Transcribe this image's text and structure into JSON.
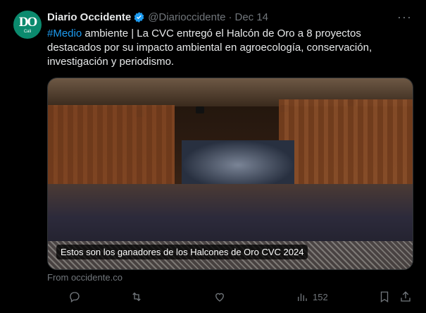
{
  "tweet": {
    "avatar_monogram": "DO",
    "avatar_sub": "Cali",
    "display_name": "Diario Occidente",
    "handle": "@Diarioccidente",
    "separator": "·",
    "date": "Dec 14",
    "more_label": "···",
    "text_hashtag": "#Medio",
    "text_body": " ambiente | La CVC entregó el Halcón de Oro a 8 proyectos destacados por su impacto ambiental en agroecología, conservación, investigación y periodismo.",
    "media_caption": "Estos son los ganadores de los Halcones de Oro CVC 2024",
    "source_link": "From occidente.co",
    "views": "152",
    "colors": {
      "link": "#1d9bf0",
      "avatar_bg": "#0b8a6e",
      "muted": "#71767b"
    }
  }
}
